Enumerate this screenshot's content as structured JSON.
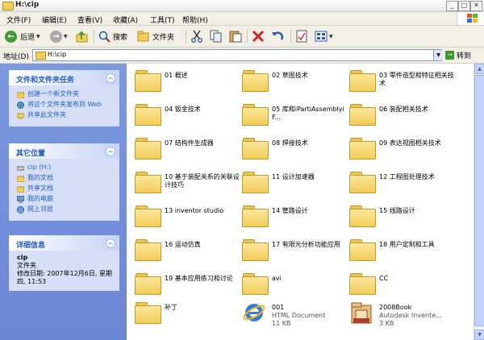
{
  "window": {
    "title": "H:\\cip",
    "min": "_",
    "max": "□",
    "close": "✕"
  },
  "menu": [
    "文件(F)",
    "编辑(E)",
    "查看(V)",
    "收藏(A)",
    "工具(T)",
    "帮助(H)"
  ],
  "toolbar": {
    "back": "后退",
    "search": "搜索",
    "folders": "文件夹",
    "back_icon": "arrow-left-icon",
    "forward_icon": "arrow-right-icon"
  },
  "address": {
    "label": "地址(D)",
    "value": "H:\\cip",
    "go": "转到"
  },
  "file_tasks": {
    "title": "文件和文件夹任务",
    "items": [
      "创建一个新文件夹",
      "将这个文件夹发布到 Web",
      "共享此文件夹"
    ]
  },
  "other_places": {
    "title": "其它位置",
    "items": [
      "cip (H:)",
      "我的文档",
      "共享文档",
      "我的电脑",
      "网上邻居"
    ]
  },
  "details": {
    "title": "详细信息",
    "name": "cip",
    "type": "文件夹",
    "modified": "修改日期: 2007年12月6日, 星期四, 11:53"
  },
  "files": [
    {
      "name": "01 概述",
      "kind": "folder"
    },
    {
      "name": "02 草图技术",
      "kind": "folder"
    },
    {
      "name": "03 零件造型和特征相关技术",
      "kind": "folder"
    },
    {
      "name": "04 钣金技术",
      "kind": "folder"
    },
    {
      "name": "05 库和iPartiAssemblyiF...",
      "kind": "folder"
    },
    {
      "name": "06 装配相关技术",
      "kind": "folder"
    },
    {
      "name": "07 结构件生成器",
      "kind": "folder"
    },
    {
      "name": "08 焊接技术",
      "kind": "folder"
    },
    {
      "name": "09 表达视图相关技术",
      "kind": "folder"
    },
    {
      "name": "10 基于装配关系的关联设计技巧",
      "kind": "folder"
    },
    {
      "name": "11 设计加速器",
      "kind": "folder"
    },
    {
      "name": "12 工程图处理技术",
      "kind": "folder"
    },
    {
      "name": "13 inventor studio",
      "kind": "folder"
    },
    {
      "name": "14 管路设计",
      "kind": "folder"
    },
    {
      "name": "15 线路设计",
      "kind": "folder"
    },
    {
      "name": "16 运动仿真",
      "kind": "folder"
    },
    {
      "name": "17 有限元分析功能应用",
      "kind": "folder"
    },
    {
      "name": "18 用户定制和工具",
      "kind": "folder"
    },
    {
      "name": "19 基本应用练习和讨论",
      "kind": "folder"
    },
    {
      "name": "avi",
      "kind": "folder"
    },
    {
      "name": "CC",
      "kind": "folder"
    },
    {
      "name": "补丁",
      "kind": "folder"
    },
    {
      "name": "001",
      "kind": "html",
      "type": "HTML Document",
      "size": "11 KB"
    },
    {
      "name": "2008Book",
      "kind": "rar",
      "type": "Autodesk Invente...",
      "size": "3 KB"
    }
  ],
  "colors": {
    "accent": "#215dc6",
    "taskpane": "#6c86d6",
    "folder": "#f1cc5a"
  }
}
